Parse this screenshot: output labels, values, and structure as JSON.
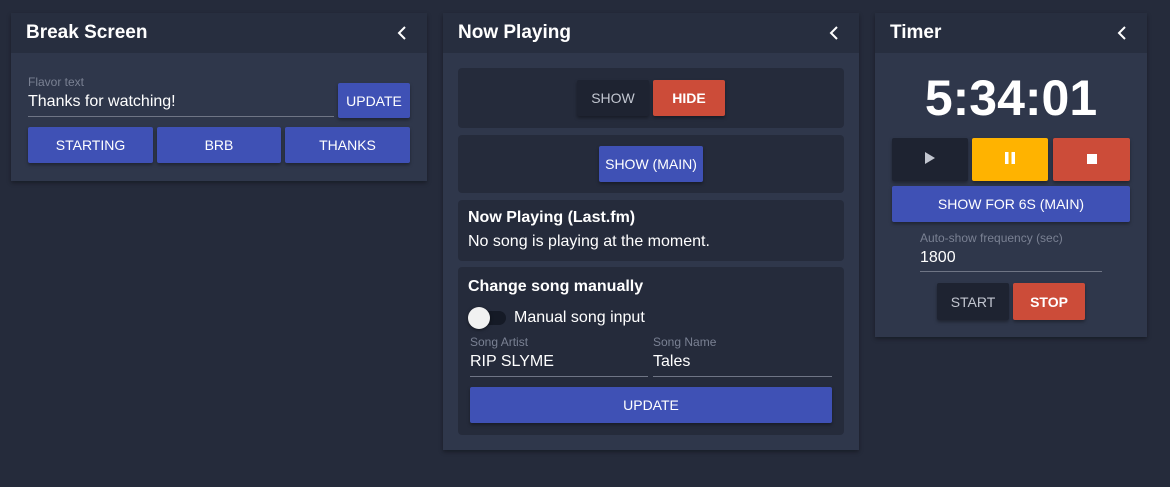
{
  "break_screen": {
    "title": "Break Screen",
    "flavor_label": "Flavor text",
    "flavor_value": "Thanks for watching!",
    "update_label": "UPDATE",
    "buttons": [
      "STARTING",
      "BRB",
      "THANKS"
    ]
  },
  "now_playing": {
    "title": "Now Playing",
    "show_label": "SHOW",
    "hide_label": "HIDE",
    "show_main_label": "SHOW (MAIN)",
    "lastfm_title": "Now Playing (Last.fm)",
    "lastfm_status": "No song is playing at the moment.",
    "manual_title": "Change song manually",
    "manual_toggle_label": "Manual song input",
    "manual_toggle_on": false,
    "artist_label": "Song Artist",
    "artist_value": "RIP SLYME",
    "song_label": "Song Name",
    "song_value": "Tales",
    "update_label": "UPDATE"
  },
  "timer": {
    "title": "Timer",
    "time": "5:34:01",
    "show_for_label": "SHOW FOR 6S (MAIN)",
    "freq_label": "Auto-show frequency (sec)",
    "freq_value": "1800",
    "start_label": "START",
    "stop_label": "STOP"
  },
  "icons": {
    "collapse": "chevron-left-icon",
    "play": "play-icon",
    "pause": "pause-icon",
    "stop": "stop-icon"
  },
  "colors": {
    "background": "#252b3b",
    "panel": "#2f374b",
    "primary": "#3f51b5",
    "danger": "#cc4c39",
    "warning": "#ffb300"
  }
}
